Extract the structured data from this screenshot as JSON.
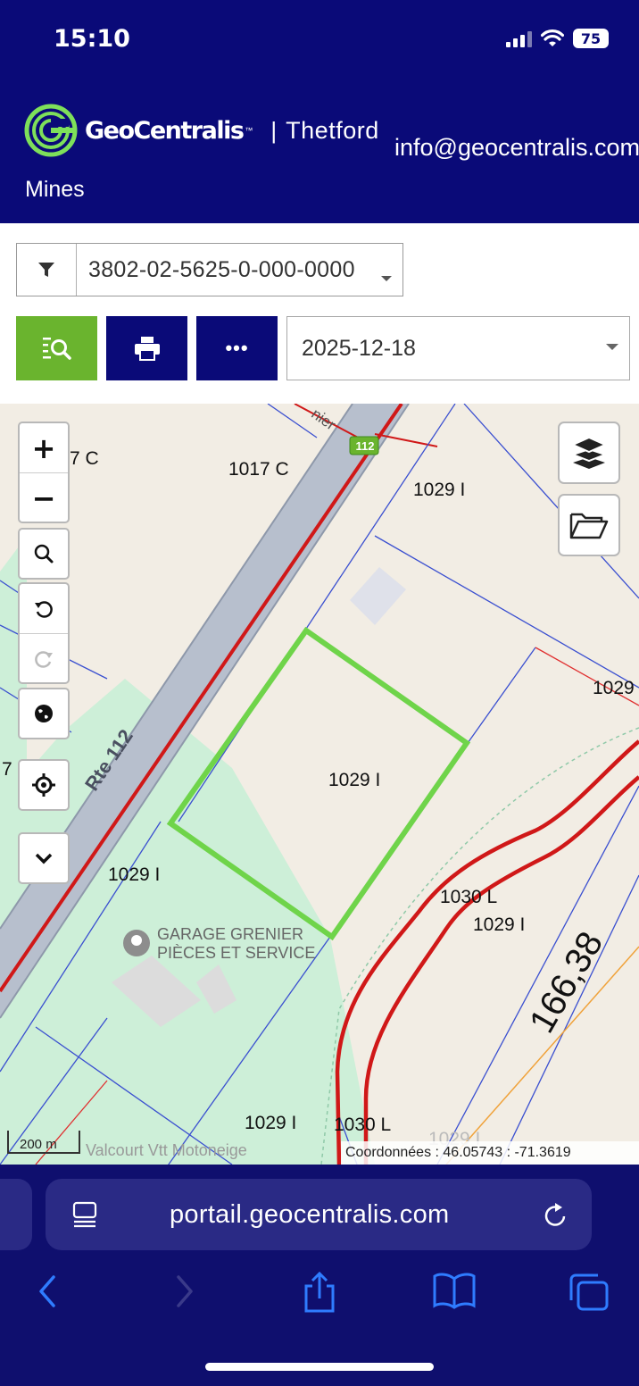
{
  "status": {
    "time": "15:10",
    "battery": "75"
  },
  "header": {
    "brand": "GeoCentralis",
    "city_line1": "Thetford",
    "city_line2": "Mines",
    "email": "info@geocentralis.com",
    "brand_color": "#0a0a78",
    "logo_color": "#7ee05a"
  },
  "controls": {
    "filter_value": "3802-02-5625-0-000-0000",
    "date_value": "2025-12-18",
    "more_label": "•••",
    "accent_green": "#6ab42e"
  },
  "map": {
    "road_label": "Rte 112",
    "route_shield": "112",
    "labels": [
      "7 C",
      "1017 C",
      "1029 I",
      "1029",
      "1029 I",
      "1029 I",
      "1030 L",
      "1029 I",
      "1029 I",
      "1030 L",
      "1029 I",
      "7",
      "nier"
    ],
    "poi_name_line1": "GARAGE GRENIER",
    "poi_name_line2": "PIÈCES ET SERVICE",
    "bottom_poi": "Valcourt Vtt Motoneige",
    "dimension": "166,38",
    "scale": "200 m",
    "coordinates": "Coordonnées : 46.05743 : -71.3619",
    "selected_parcel_color": "#6fd44a",
    "lot_line_color": "#3a4fd0",
    "road_line_color": "#d01818"
  },
  "browser": {
    "url": "portail.geocentralis.com"
  }
}
